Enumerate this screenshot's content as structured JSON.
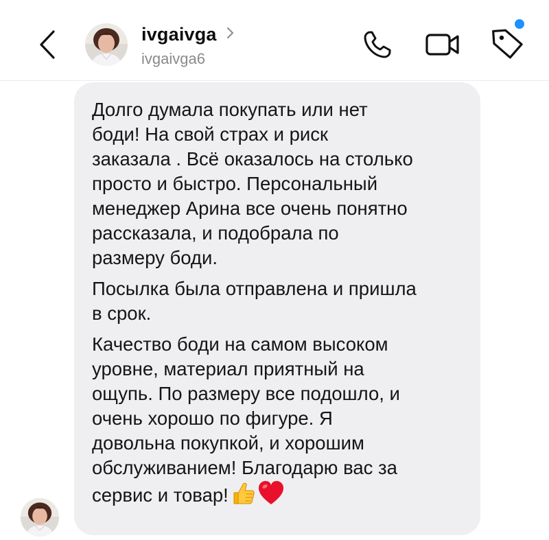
{
  "header": {
    "username": "ivgaivga",
    "handle": "ivgaivga6",
    "icons": {
      "back": "chevron-left-icon",
      "profile_chevron": "chevron-right-icon",
      "phone": "phone-icon",
      "video": "video-camera-icon",
      "tag": "tag-icon",
      "notification": "blue-dot-indicator"
    },
    "accent_color": "#1e90ff"
  },
  "message": {
    "paragraphs": [
      "Долго думала покупать или нет\nбоди! На свой страх и риск\nзаказала . Всё оказалось на столько\nпросто  и быстро. Персональный\nменеджер Арина все очень понятно\nрассказала, и подобрала по\nразмеру  боди.",
      "Посылка была отправлена и пришла\nв срок.",
      "Качество боди на самом высоком\nуровне, материал приятный на\nощупь. По размеру все подошло, и\nочень хорошо по фигуре. Я\nдовольна покупкой, и хорошим\nобслуживанием! Благодарю вас за\nсервис и товар!"
    ],
    "emojis": [
      "thumbs-up-emoji",
      "red-heart-emoji"
    ],
    "bubble_color": "#efeff1"
  }
}
